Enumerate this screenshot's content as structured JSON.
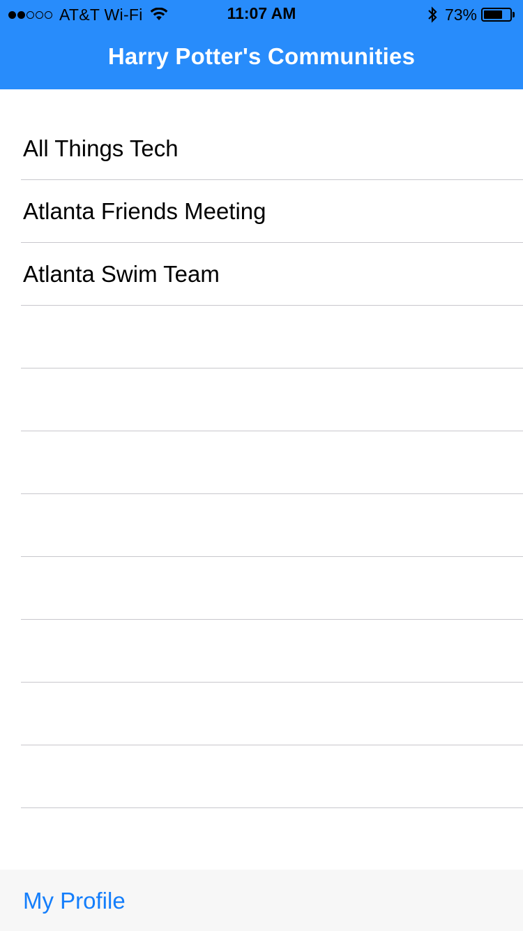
{
  "status_bar": {
    "carrier": "AT&T Wi-Fi",
    "time": "11:07 AM",
    "battery_percent": "73%",
    "battery_level": 0.73,
    "signal_bars_filled": 2,
    "signal_bars_total": 5
  },
  "nav": {
    "title": "Harry Potter's Communities"
  },
  "communities": [
    "All Things Tech",
    "Atlanta Friends Meeting",
    "Atlanta Swim Team"
  ],
  "empty_row_count": 8,
  "toolbar": {
    "my_profile_label": "My Profile"
  },
  "colors": {
    "nav_background": "#288cfb",
    "link_blue": "#147efb",
    "separator": "#c8c7cc",
    "toolbar_background": "#f7f7f7"
  },
  "icons": {
    "wifi": "wifi-icon",
    "bluetooth": "bluetooth-icon",
    "battery": "battery-icon"
  }
}
